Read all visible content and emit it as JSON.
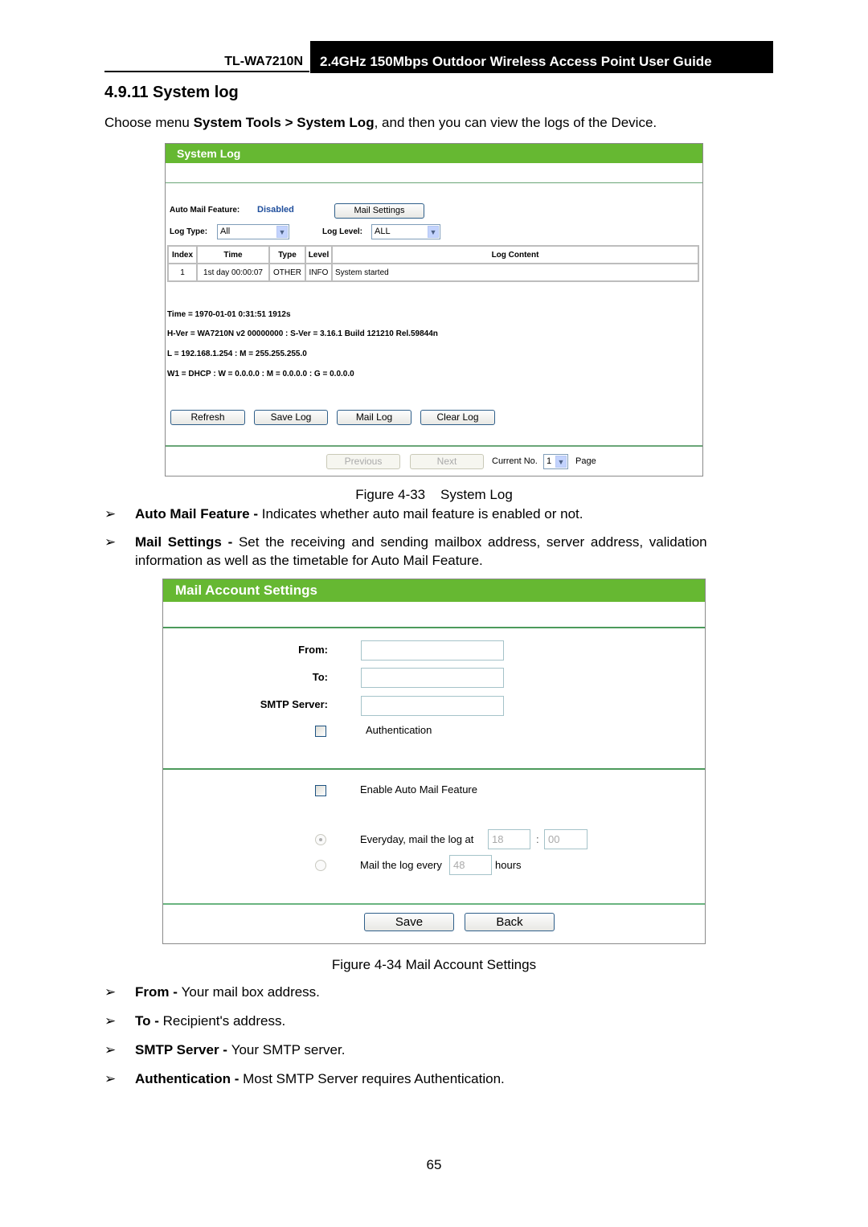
{
  "header": {
    "model": "TL-WA7210N",
    "guide_title": "2.4GHz 150Mbps Outdoor Wireless Access Point User Guide"
  },
  "section": {
    "title": "4.9.11 System log",
    "intro_prefix": "Choose menu ",
    "intro_bold": "System Tools > System Log",
    "intro_suffix": ", and then you can view the logs of the Device."
  },
  "system_log": {
    "panel_title": "System Log",
    "auto_mail_label": "Auto Mail Feature:",
    "auto_mail_value": "Disabled",
    "auto_mail_value_color": "#1f4e9c",
    "mail_settings_button": "Mail Settings",
    "log_type_label": "Log Type:",
    "log_type_value": "All",
    "log_level_label": "Log Level:",
    "log_level_value": "ALL",
    "table": {
      "headers": [
        "Index",
        "Time",
        "Type",
        "Level",
        "Log Content"
      ],
      "rows": [
        [
          "1",
          "1st day 00:00:07",
          "OTHER",
          "INFO",
          "System started"
        ]
      ]
    },
    "info_lines": [
      "Time = 1970-01-01 0:31:51 1912s",
      "H-Ver = WA7210N v2 00000000 : S-Ver = 3.16.1 Build 121210 Rel.59844n",
      "L = 192.168.1.254 : M = 255.255.255.0",
      "W1 = DHCP : W = 0.0.0.0 : M = 0.0.0.0 : G = 0.0.0.0"
    ],
    "buttons": {
      "refresh": "Refresh",
      "save_log": "Save Log",
      "mail_log": "Mail Log",
      "clear_log": "Clear Log"
    },
    "pager": {
      "previous": "Previous",
      "next": "Next",
      "current_label": "Current No.",
      "current_value": "1",
      "page_label": "Page"
    }
  },
  "figure_33_caption": "Figure 4-33    System Log",
  "bullets_1": [
    {
      "term": "Auto Mail Feature - ",
      "desc": "Indicates whether auto mail feature is enabled or not."
    },
    {
      "term": "Mail Settings - ",
      "desc": "Set the receiving and sending mailbox address, server address, validation",
      "desc2": "information as well as the timetable for Auto Mail Feature."
    }
  ],
  "mail_account": {
    "panel_title": "Mail Account Settings",
    "from_label": "From:",
    "from_value": "",
    "to_label": "To:",
    "to_value": "",
    "smtp_label": "SMTP Server:",
    "smtp_value": "",
    "authentication_label": "Authentication",
    "authentication_checked": false,
    "enable_auto_mail_label": "Enable Auto Mail Feature",
    "enable_auto_mail_checked": false,
    "everyday_label": "Everyday, mail the log at",
    "everyday_hour": "18",
    "time_separator": ":",
    "everyday_minute": "00",
    "every_label": "Mail the log every",
    "every_hours_value": "48",
    "hours_label": "hours",
    "selected_schedule": "everyday",
    "save_button": "Save",
    "back_button": "Back"
  },
  "figure_34_caption": "Figure 4-34 Mail Account Settings",
  "bullets_2": [
    {
      "term": "From - ",
      "desc": "Your mail box address."
    },
    {
      "term": "To - ",
      "desc": "Recipient's address."
    },
    {
      "term": "SMTP Server - ",
      "desc": "Your SMTP server."
    },
    {
      "term": "Authentication - ",
      "desc": "Most SMTP Server requires Authentication."
    }
  ],
  "bullet_glyph": "➢",
  "page_number": "65"
}
